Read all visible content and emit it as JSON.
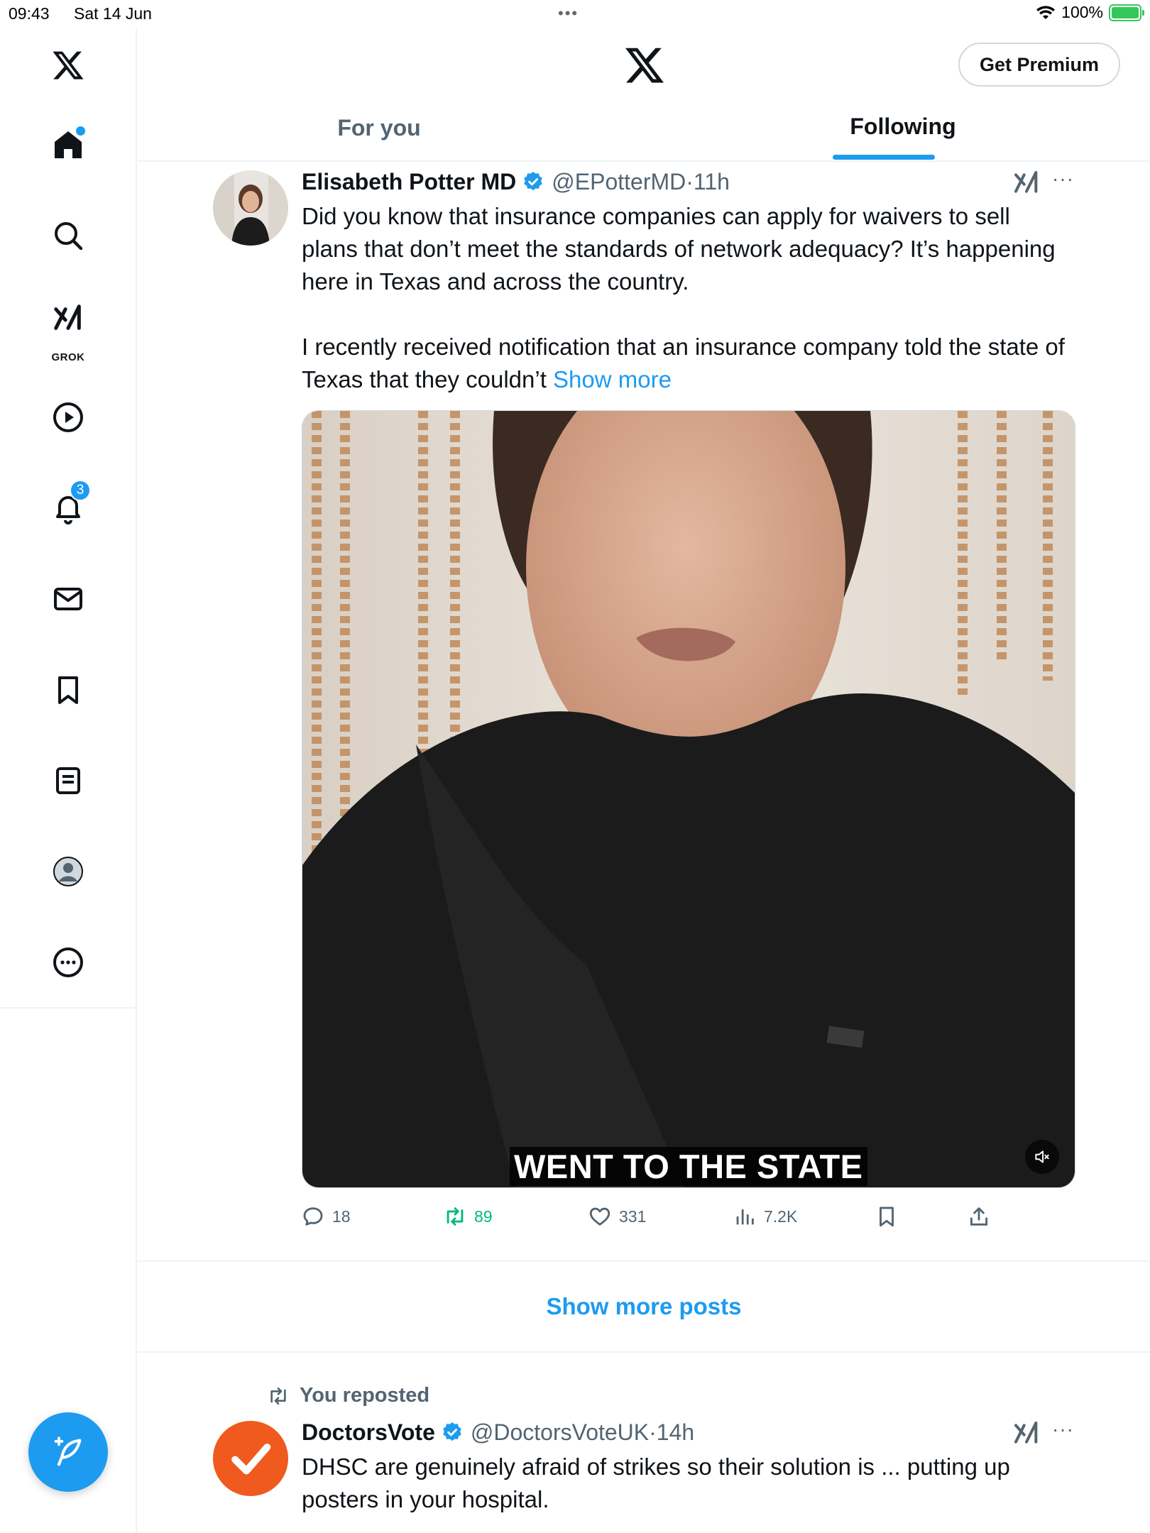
{
  "status_bar": {
    "time": "09:43",
    "date": "Sat 14 Jun",
    "battery": "100%"
  },
  "sidebar": {
    "items": [
      {
        "icon": "x-logo-icon"
      },
      {
        "icon": "home-icon",
        "has_dot": true
      },
      {
        "icon": "search-icon"
      },
      {
        "icon": "grok-icon",
        "label": "GROK"
      },
      {
        "icon": "video-play-icon"
      },
      {
        "icon": "bell-icon",
        "badge": "3"
      },
      {
        "icon": "mail-icon"
      },
      {
        "icon": "bookmark-icon"
      },
      {
        "icon": "list-icon"
      },
      {
        "icon": "profile-icon"
      },
      {
        "icon": "more-circle-icon"
      }
    ],
    "compose_icon": "compose-feather-icon"
  },
  "header": {
    "premium_label": "Get Premium",
    "tabs": [
      {
        "label": "For you",
        "active": false
      },
      {
        "label": "Following",
        "active": true
      }
    ]
  },
  "tweet1": {
    "name": "Elisabeth Potter MD",
    "handle": "@EPotterMD",
    "time": "11h",
    "text_before": "Did you know that insurance companies can apply for waivers to sell plans that don’t meet the standards of network adequacy? It’s happening here in Texas and across the country.\n\nI recently received notification that an insurance company told the state of Texas that they couldn’t ",
    "show_more": "Show more",
    "video_caption": "WENT TO THE STATE",
    "stats": {
      "replies": "18",
      "reposts": "89",
      "likes": "331",
      "views": "7.2K"
    }
  },
  "show_more_posts": "Show more posts",
  "tweet2": {
    "repost_label": "You reposted",
    "name": "DoctorsVote",
    "handle": "@DoctorsVoteUK",
    "time": "14h",
    "text": "DHSC are genuinely afraid of strikes so their solution is ... putting up posters in your hospital."
  },
  "colors": {
    "accent": "#1d9bf0",
    "retweet_green": "#00ba7c",
    "secondary_text": "#536471",
    "border": "#eff3f4",
    "doctorsvote_orange": "#f05a1e"
  }
}
